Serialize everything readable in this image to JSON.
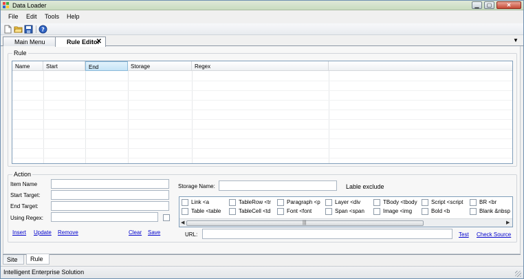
{
  "window": {
    "title": "Data Loader"
  },
  "menu": {
    "items": [
      "File",
      "Edit",
      "Tools",
      "Help"
    ]
  },
  "toolbar": {
    "icons": [
      "new-icon",
      "open-icon",
      "save-icon",
      "help-icon"
    ]
  },
  "tabs": {
    "main_menu": "Main Menu",
    "rule_editor": "Rule Editor",
    "close_glyph": "✕",
    "menu_glyph": "▼"
  },
  "rule": {
    "legend": "Rule",
    "columns": [
      "Name",
      "Start",
      "End",
      "Storage",
      "Regex"
    ],
    "selected_column": "End"
  },
  "action": {
    "legend": "Action",
    "item_name_label": "Item Name",
    "start_target_label": "Start Target:",
    "end_target_label": "End Target:",
    "using_regex_label": "Using Regex:",
    "storage_name_label": "Storage Name:",
    "lable_exclude": "Lable exclude",
    "url_label": "URL:",
    "links": {
      "insert": "Insert",
      "update": "Update",
      "remove": "Remove",
      "clear": "Clear",
      "save": "Save",
      "test": "Test",
      "check_source": "Check Source"
    },
    "tags_row1": [
      "Link <a",
      "TableRow <tr",
      "Paragraph <p",
      "Layer <div",
      "TBody <tbody",
      "Script <script",
      "BR <br"
    ],
    "tags_row2": [
      "Table <table",
      "TableCell <td",
      "Font <font",
      "Span <span",
      "Image <img",
      "Bold <b",
      "Blank &nbsp"
    ],
    "scroll_grip": "|||"
  },
  "bottom_tabs": [
    "Site",
    "Rule"
  ],
  "status": {
    "text": "Intelligent Enterprise Solution"
  }
}
